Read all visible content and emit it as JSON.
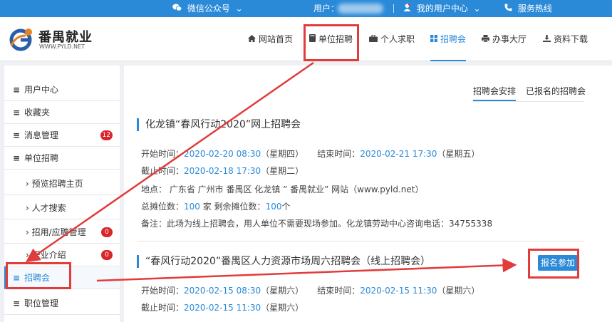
{
  "topbar": {
    "wechat": "微信公众号",
    "user_label": "用户：",
    "user_center": "我的用户中心",
    "hotline": "服务热线"
  },
  "logo": {
    "name": "番禺就业",
    "url": "WWW.PYLD.NET"
  },
  "nav": {
    "home": "网站首页",
    "employer": "单位招聘",
    "seeker": "个人求职",
    "fair": "招聘会",
    "hall": "办事大厅",
    "download": "资料下载"
  },
  "sidebar": {
    "items": [
      {
        "label": "用户中心"
      },
      {
        "label": "收藏夹"
      },
      {
        "label": "消息管理",
        "badge": "12"
      },
      {
        "label": "单位招聘"
      },
      {
        "label": "预览招聘主页"
      },
      {
        "label": "人才搜索"
      },
      {
        "label": "招用/应聘管理",
        "badge": "0"
      },
      {
        "label": "职业介绍",
        "badge": "0"
      },
      {
        "label": "招聘会"
      },
      {
        "label": "职位管理"
      }
    ]
  },
  "tabs": {
    "schedule": "招聘会安排",
    "registered": "已报名的招聘会"
  },
  "fairs": [
    {
      "title": "化龙镇“春风行动2020”网上招聘会",
      "start_label": "开始时间：",
      "start": "2020-02-20 08:30",
      "start_week": "（星期四）",
      "end_label": "结束时间：",
      "end": "2020-02-21 17:30",
      "end_week": "（星期五）",
      "deadline_label": "截止时间：",
      "deadline": "2020-02-18 17:30",
      "deadline_week": "（星期二）",
      "location": "地点： 广东省 广州市 番禺区 化龙镇 ” 番禺就业” 网站（www.pyld.net）",
      "booths_label": "总摊位数：",
      "booths": "100",
      "booths_unit": " 家  剩余摊位数：",
      "remaining": "100",
      "remaining_unit": "个",
      "note": "备注：此场为线上招聘会，用人单位不需要现场参加。化龙镇劳动中心咨询电话：34755338"
    },
    {
      "title": "“春风行动2020”番禺区人力资源市场周六招聘会（线上招聘会）",
      "apply_button": "报名参加",
      "start_label": "开始时间：",
      "start": "2020-02-15 08:30",
      "start_week": "（星期六）",
      "end_label": "结束时间：",
      "end": "2020-02-15 11:30",
      "end_week": "（星期六）",
      "deadline_label": "截止时间：",
      "deadline": "2020-02-15 11:30",
      "deadline_week": "（星期六）"
    }
  ],
  "colors": {
    "accent": "#2a8ad8",
    "annotation": "#e23b3b",
    "badge": "#d9262b"
  }
}
